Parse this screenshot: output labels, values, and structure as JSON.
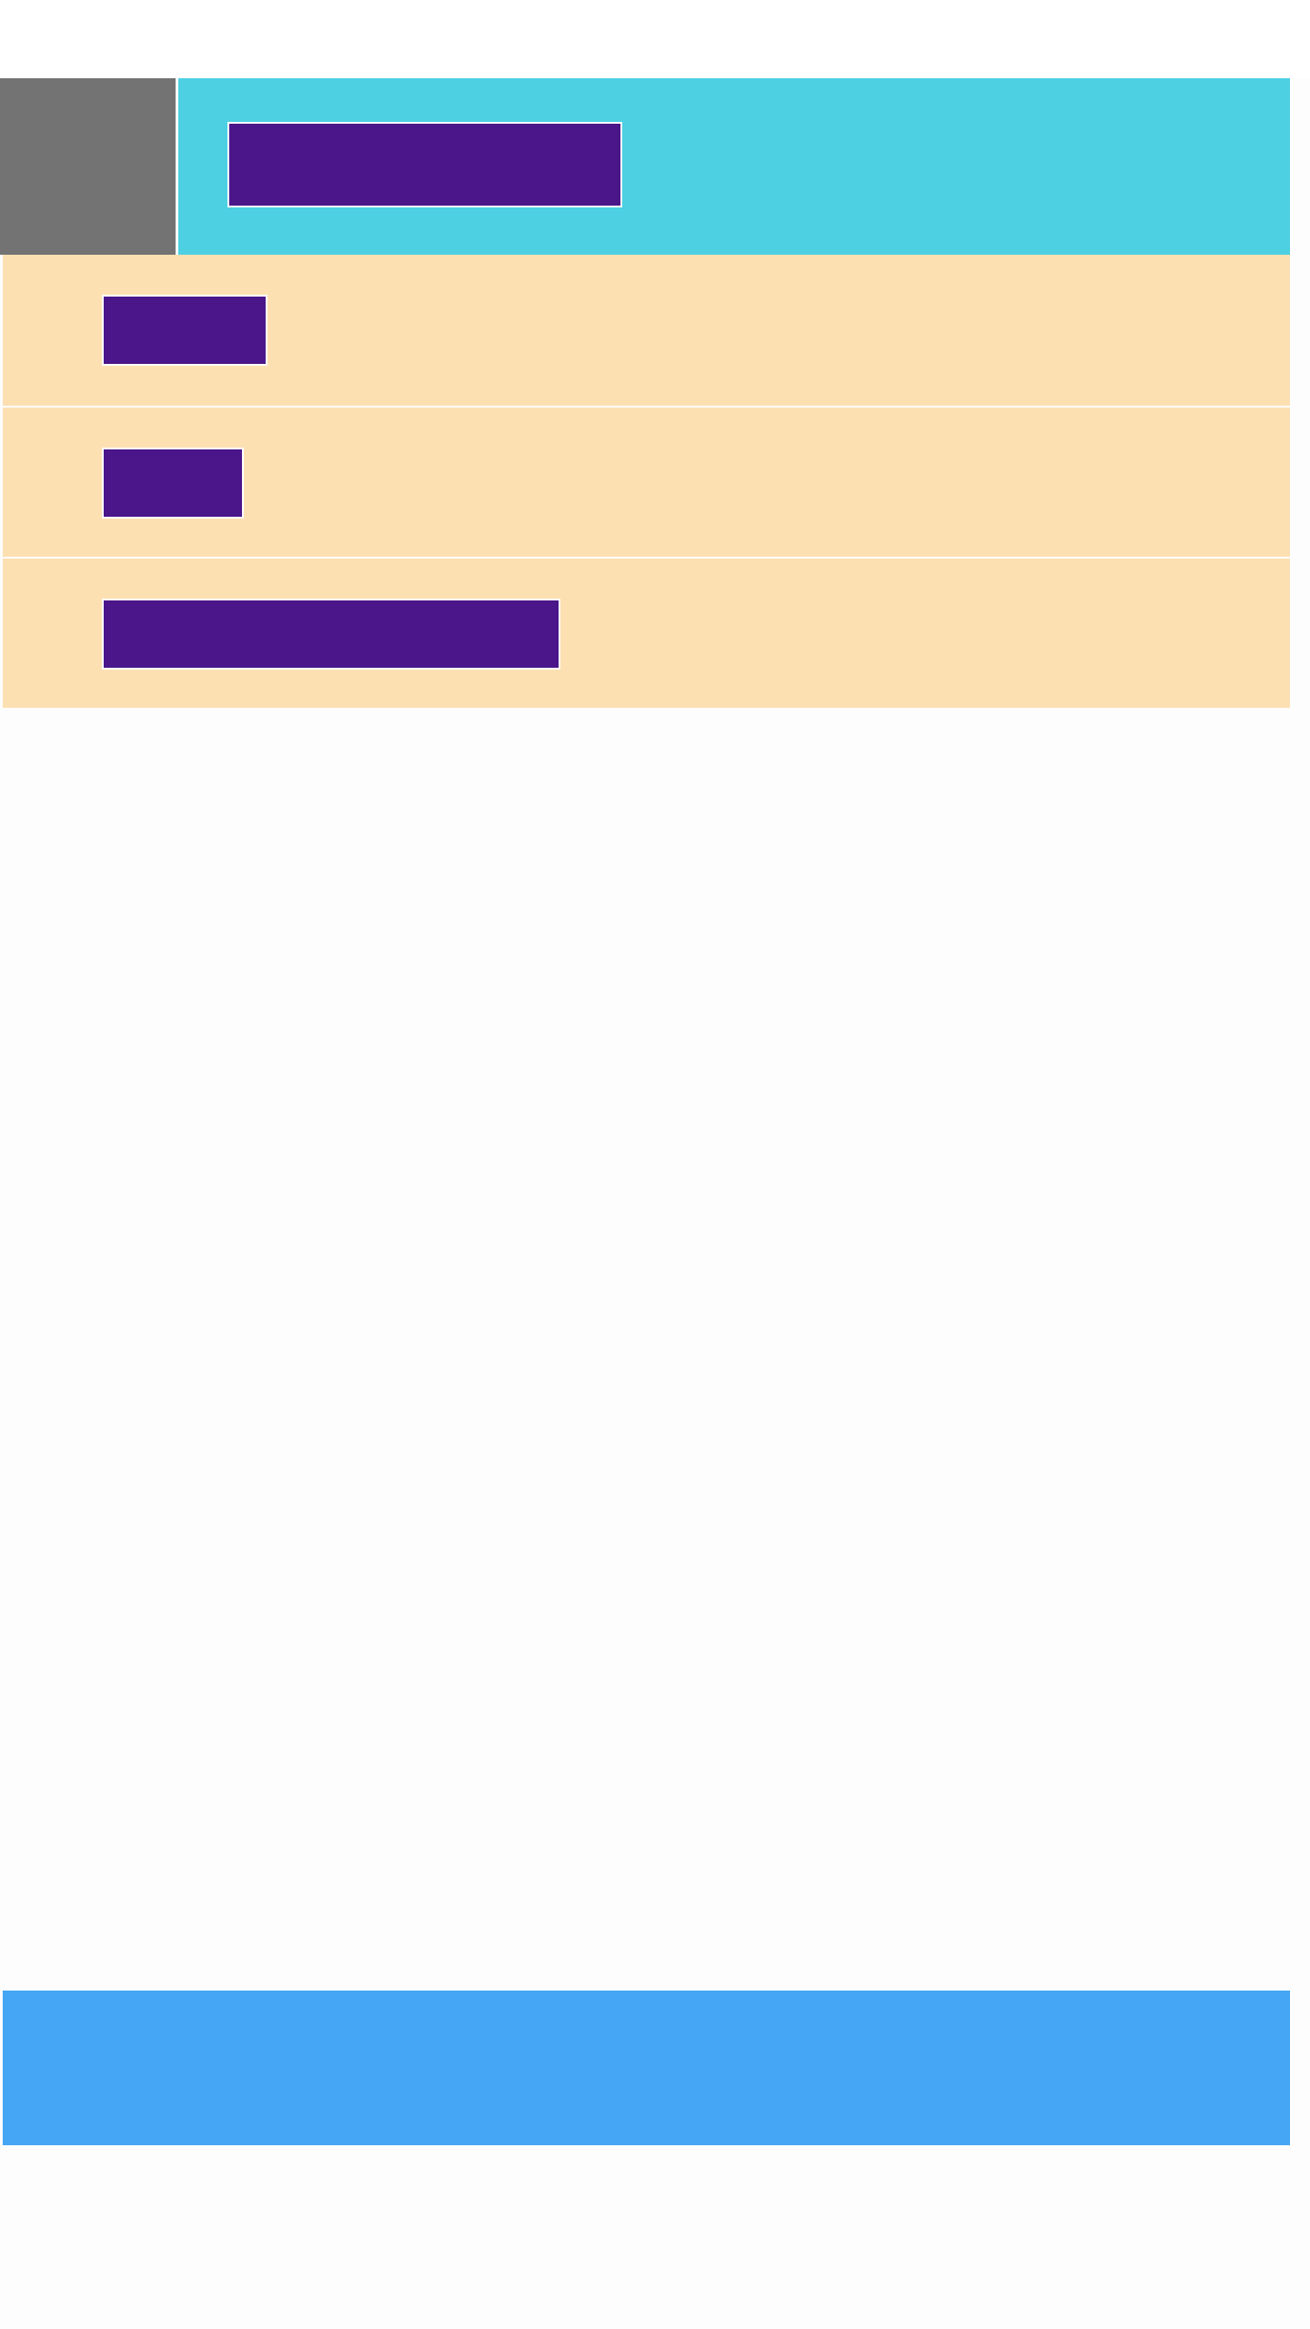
{
  "app_bar": {
    "title": "",
    "color": "#4dd0e2",
    "nav_icon": "menu-icon"
  },
  "menu": {
    "items": [
      {
        "label": ""
      },
      {
        "label": ""
      },
      {
        "label": ""
      }
    ],
    "item_color": "#fde0b2",
    "label_color": "#4a168a"
  },
  "bottom_bar": {
    "color": "#44a6f4"
  }
}
